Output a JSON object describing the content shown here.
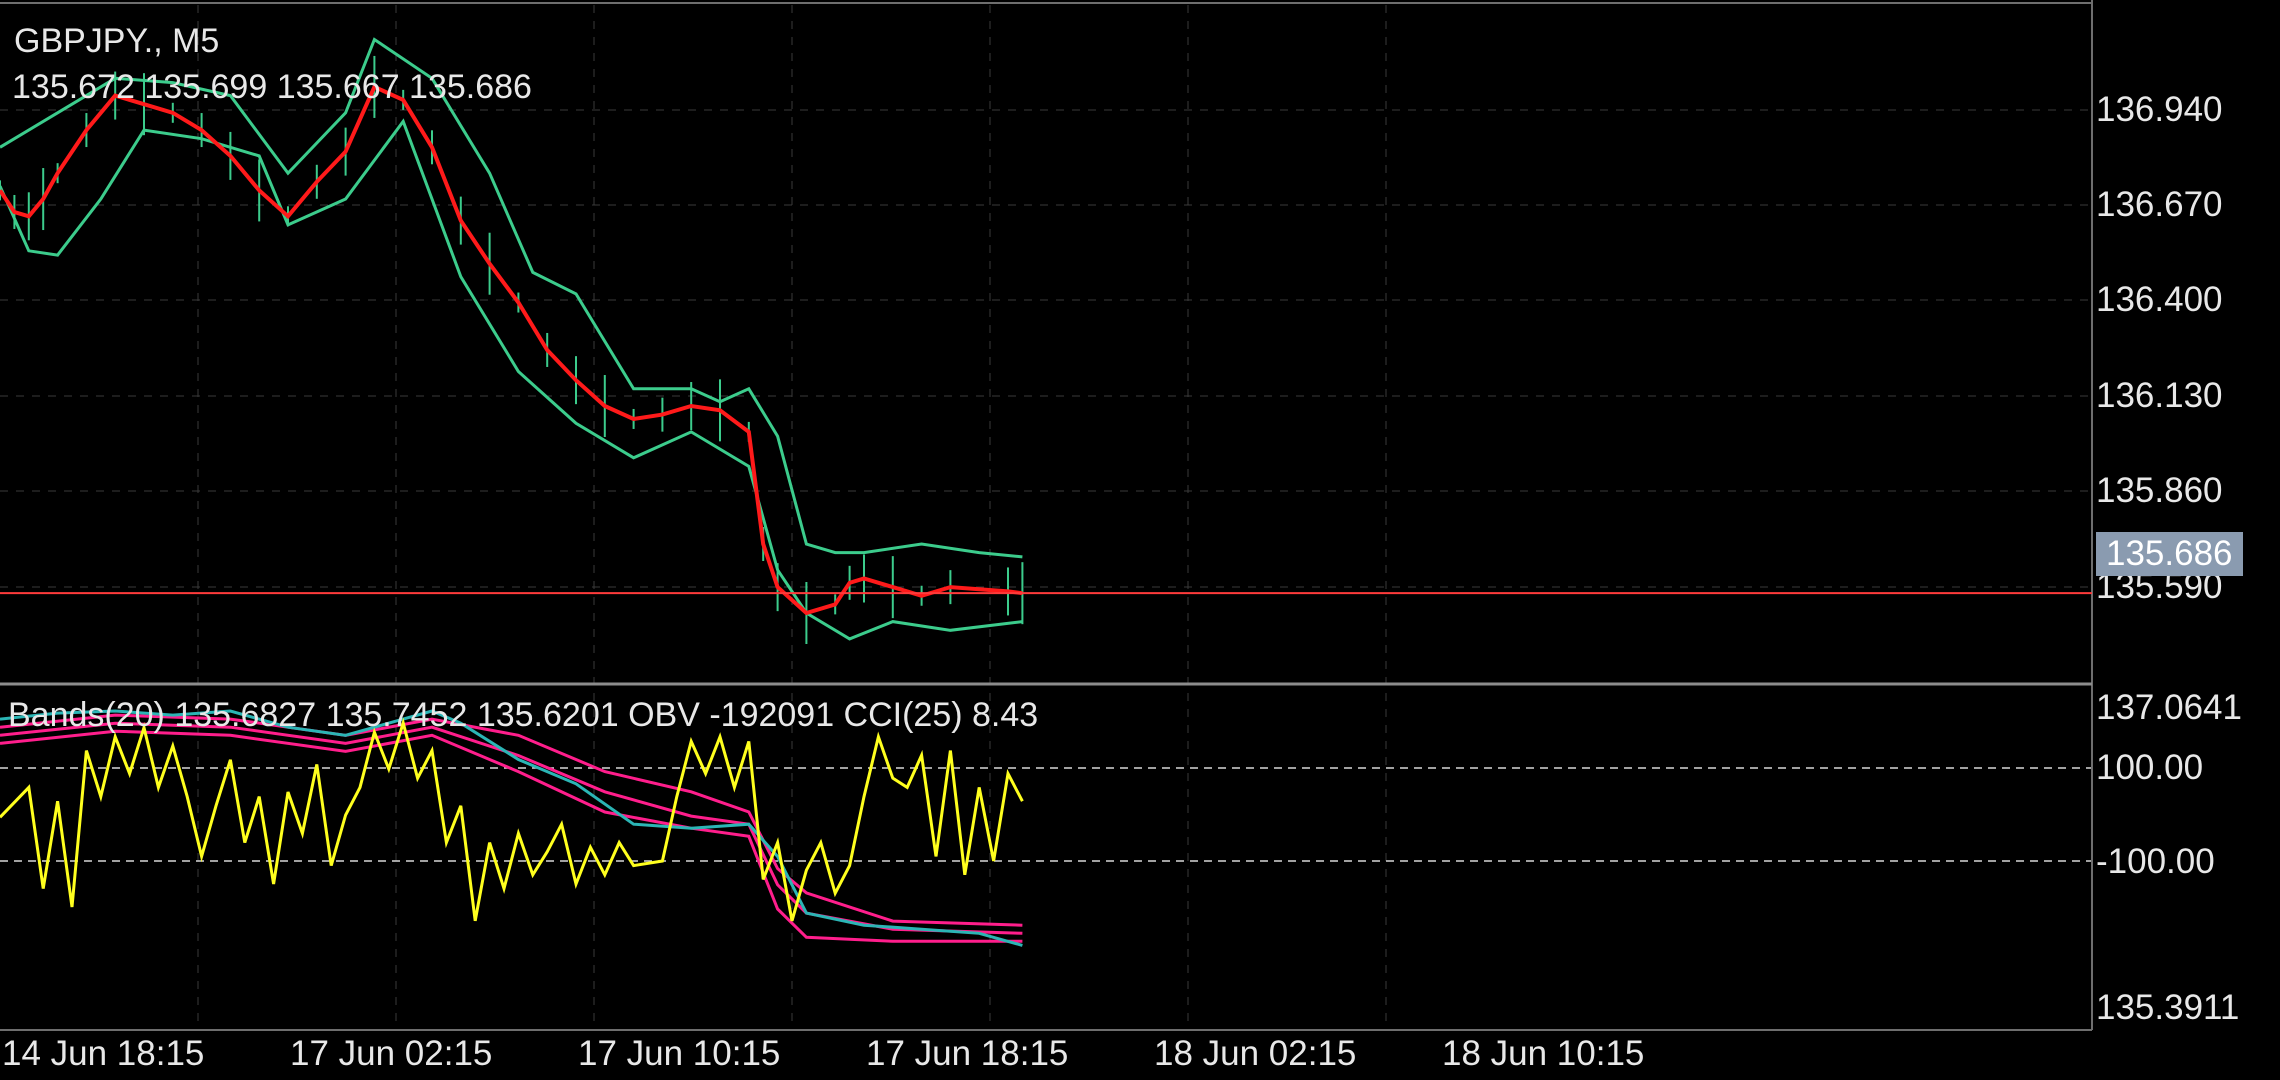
{
  "header": {
    "symbol": "GBPJPY., M5",
    "ohlc": "135.672 135.699 135.667 135.686"
  },
  "main_axis": {
    "ticks": [
      "136.940",
      "136.670",
      "136.400",
      "136.130",
      "135.860",
      "135.590"
    ],
    "current_price": "135.686"
  },
  "indicator": {
    "legend": "Bands(20) 135.6827 135.7452 135.6201 OBV -192091 CCI(25) 8.43",
    "ticks": [
      "137.0641",
      "100.00",
      "-100.00",
      "135.3911"
    ]
  },
  "time_axis": [
    "14 Jun 18:15",
    "17 Jun 02:15",
    "17 Jun 10:15",
    "17 Jun 18:15",
    "18 Jun 02:15",
    "18 Jun 10:15"
  ],
  "colors": {
    "background": "#000000",
    "grid": "#3a3a3a",
    "price": "#ff1a1a",
    "bands": "#3ccc8c",
    "current_line": "#ff3b3b",
    "bands_sub": "#ff1e8c",
    "obv": "#2bb5b5",
    "cci": "#ffff1e",
    "badge": "#8a9bb0"
  },
  "chart_data": {
    "type": "line",
    "title": "GBPJPY., M5",
    "x": [
      "14 Jun 18:15",
      "17 Jun 02:15",
      "17 Jun 10:15",
      "17 Jun 18:15",
      "18 Jun 02:15",
      "18 Jun 10:15"
    ],
    "main_ylim": [
      135.48,
      137.05
    ],
    "current_price": 135.686,
    "price_path": [
      [
        0,
        136.62
      ],
      [
        0.05,
        136.57
      ],
      [
        0.1,
        136.56
      ],
      [
        0.15,
        136.6
      ],
      [
        0.2,
        136.66
      ],
      [
        0.3,
        136.76
      ],
      [
        0.4,
        136.84
      ],
      [
        0.5,
        136.82
      ],
      [
        0.6,
        136.8
      ],
      [
        0.7,
        136.76
      ],
      [
        0.8,
        136.7
      ],
      [
        0.9,
        136.62
      ],
      [
        1.0,
        136.56
      ],
      [
        1.1,
        136.64
      ],
      [
        1.2,
        136.71
      ],
      [
        1.3,
        136.86
      ],
      [
        1.4,
        136.83
      ],
      [
        1.5,
        136.72
      ],
      [
        1.6,
        136.55
      ],
      [
        1.7,
        136.45
      ],
      [
        1.8,
        136.36
      ],
      [
        1.9,
        136.25
      ],
      [
        2.0,
        136.18
      ],
      [
        2.1,
        136.12
      ],
      [
        2.2,
        136.09
      ],
      [
        2.3,
        136.1
      ],
      [
        2.4,
        136.12
      ],
      [
        2.5,
        136.11
      ],
      [
        2.6,
        136.06
      ],
      [
        2.65,
        135.8
      ],
      [
        2.7,
        135.7
      ],
      [
        2.8,
        135.64
      ],
      [
        2.9,
        135.66
      ],
      [
        2.95,
        135.71
      ],
      [
        3.0,
        135.72
      ],
      [
        3.1,
        135.7
      ],
      [
        3.2,
        135.68
      ],
      [
        3.3,
        135.7
      ],
      [
        3.5,
        135.69
      ],
      [
        3.55,
        135.686
      ]
    ],
    "band_upper": [
      [
        0,
        136.72
      ],
      [
        0.2,
        136.8
      ],
      [
        0.4,
        136.88
      ],
      [
        0.6,
        136.87
      ],
      [
        0.8,
        136.84
      ],
      [
        1.0,
        136.66
      ],
      [
        1.2,
        136.8
      ],
      [
        1.3,
        136.97
      ],
      [
        1.5,
        136.88
      ],
      [
        1.7,
        136.66
      ],
      [
        1.85,
        136.43
      ],
      [
        2.0,
        136.38
      ],
      [
        2.2,
        136.16
      ],
      [
        2.4,
        136.16
      ],
      [
        2.5,
        136.13
      ],
      [
        2.6,
        136.16
      ],
      [
        2.7,
        136.05
      ],
      [
        2.8,
        135.8
      ],
      [
        2.9,
        135.78
      ],
      [
        3.0,
        135.78
      ],
      [
        3.2,
        135.8
      ],
      [
        3.4,
        135.78
      ],
      [
        3.55,
        135.77
      ]
    ],
    "band_lower": [
      [
        0,
        136.63
      ],
      [
        0.1,
        136.48
      ],
      [
        0.2,
        136.47
      ],
      [
        0.35,
        136.6
      ],
      [
        0.5,
        136.76
      ],
      [
        0.7,
        136.74
      ],
      [
        0.9,
        136.7
      ],
      [
        1.0,
        136.54
      ],
      [
        1.2,
        136.6
      ],
      [
        1.4,
        136.78
      ],
      [
        1.6,
        136.42
      ],
      [
        1.8,
        136.2
      ],
      [
        2.0,
        136.08
      ],
      [
        2.2,
        136.0
      ],
      [
        2.4,
        136.06
      ],
      [
        2.6,
        135.98
      ],
      [
        2.7,
        135.74
      ],
      [
        2.8,
        135.64
      ],
      [
        2.95,
        135.58
      ],
      [
        3.1,
        135.62
      ],
      [
        3.3,
        135.6
      ],
      [
        3.55,
        135.62
      ]
    ],
    "sub_ylim": [
      135.3911,
      137.0641
    ],
    "bands_sub_values": {
      "middle": 135.6827,
      "upper": 135.7452,
      "lower": 135.6201
    },
    "obv_last": -192091,
    "cci_last": 8.43,
    "cci_levels": [
      100,
      -100
    ],
    "cci_path": [
      [
        0,
        -5
      ],
      [
        0.1,
        60
      ],
      [
        0.15,
        -160
      ],
      [
        0.2,
        30
      ],
      [
        0.25,
        -200
      ],
      [
        0.3,
        140
      ],
      [
        0.35,
        40
      ],
      [
        0.4,
        170
      ],
      [
        0.45,
        90
      ],
      [
        0.5,
        190
      ],
      [
        0.55,
        60
      ],
      [
        0.6,
        150
      ],
      [
        0.65,
        40
      ],
      [
        0.7,
        -90
      ],
      [
        0.75,
        20
      ],
      [
        0.8,
        120
      ],
      [
        0.85,
        -60
      ],
      [
        0.9,
        40
      ],
      [
        0.95,
        -150
      ],
      [
        1.0,
        50
      ],
      [
        1.05,
        -40
      ],
      [
        1.1,
        110
      ],
      [
        1.15,
        -110
      ],
      [
        1.2,
        0
      ],
      [
        1.25,
        60
      ],
      [
        1.3,
        180
      ],
      [
        1.35,
        100
      ],
      [
        1.4,
        200
      ],
      [
        1.45,
        80
      ],
      [
        1.5,
        140
      ],
      [
        1.55,
        -60
      ],
      [
        1.6,
        20
      ],
      [
        1.65,
        -230
      ],
      [
        1.7,
        -60
      ],
      [
        1.75,
        -160
      ],
      [
        1.8,
        -40
      ],
      [
        1.85,
        -130
      ],
      [
        1.9,
        -80
      ],
      [
        1.95,
        -20
      ],
      [
        2.0,
        -150
      ],
      [
        2.05,
        -70
      ],
      [
        2.1,
        -130
      ],
      [
        2.15,
        -60
      ],
      [
        2.2,
        -110
      ],
      [
        2.3,
        -100
      ],
      [
        2.35,
        40
      ],
      [
        2.4,
        160
      ],
      [
        2.45,
        90
      ],
      [
        2.5,
        170
      ],
      [
        2.55,
        60
      ],
      [
        2.6,
        160
      ],
      [
        2.65,
        -140
      ],
      [
        2.7,
        -60
      ],
      [
        2.75,
        -230
      ],
      [
        2.8,
        -120
      ],
      [
        2.85,
        -60
      ],
      [
        2.9,
        -170
      ],
      [
        2.95,
        -110
      ],
      [
        3.0,
        40
      ],
      [
        3.05,
        170
      ],
      [
        3.1,
        80
      ],
      [
        3.15,
        60
      ],
      [
        3.2,
        130
      ],
      [
        3.25,
        -90
      ],
      [
        3.3,
        140
      ],
      [
        3.35,
        -130
      ],
      [
        3.4,
        60
      ],
      [
        3.45,
        -100
      ],
      [
        3.5,
        90
      ],
      [
        3.55,
        30
      ]
    ],
    "obv_path": [
      [
        0,
        136.92
      ],
      [
        0.2,
        136.95
      ],
      [
        0.4,
        136.96
      ],
      [
        0.6,
        136.94
      ],
      [
        0.8,
        136.96
      ],
      [
        1.0,
        136.88
      ],
      [
        1.2,
        136.84
      ],
      [
        1.4,
        136.92
      ],
      [
        1.5,
        136.96
      ],
      [
        1.6,
        136.9
      ],
      [
        1.8,
        136.72
      ],
      [
        2.0,
        136.6
      ],
      [
        2.2,
        136.4
      ],
      [
        2.4,
        136.38
      ],
      [
        2.6,
        136.4
      ],
      [
        2.7,
        136.24
      ],
      [
        2.8,
        135.96
      ],
      [
        3.0,
        135.9
      ],
      [
        3.2,
        135.88
      ],
      [
        3.4,
        135.86
      ],
      [
        3.55,
        135.8
      ]
    ],
    "band_sub_upper": [
      [
        0,
        136.88
      ],
      [
        0.4,
        136.94
      ],
      [
        0.8,
        136.92
      ],
      [
        1.2,
        136.84
      ],
      [
        1.5,
        136.92
      ],
      [
        1.8,
        136.84
      ],
      [
        2.1,
        136.66
      ],
      [
        2.4,
        136.56
      ],
      [
        2.6,
        136.46
      ],
      [
        2.7,
        136.18
      ],
      [
        2.8,
        136.06
      ],
      [
        3.1,
        135.92
      ],
      [
        3.55,
        135.9
      ]
    ],
    "band_sub_middle": [
      [
        0,
        136.84
      ],
      [
        0.4,
        136.9
      ],
      [
        0.8,
        136.88
      ],
      [
        1.2,
        136.8
      ],
      [
        1.5,
        136.88
      ],
      [
        1.8,
        136.74
      ],
      [
        2.1,
        136.56
      ],
      [
        2.4,
        136.44
      ],
      [
        2.6,
        136.4
      ],
      [
        2.7,
        136.1
      ],
      [
        2.8,
        135.96
      ],
      [
        3.1,
        135.88
      ],
      [
        3.55,
        135.86
      ]
    ],
    "band_sub_lower": [
      [
        0,
        136.8
      ],
      [
        0.4,
        136.86
      ],
      [
        0.8,
        136.84
      ],
      [
        1.2,
        136.76
      ],
      [
        1.5,
        136.84
      ],
      [
        1.8,
        136.66
      ],
      [
        2.1,
        136.46
      ],
      [
        2.4,
        136.38
      ],
      [
        2.6,
        136.34
      ],
      [
        2.7,
        135.98
      ],
      [
        2.8,
        135.84
      ],
      [
        3.1,
        135.82
      ],
      [
        3.55,
        135.82
      ]
    ]
  }
}
